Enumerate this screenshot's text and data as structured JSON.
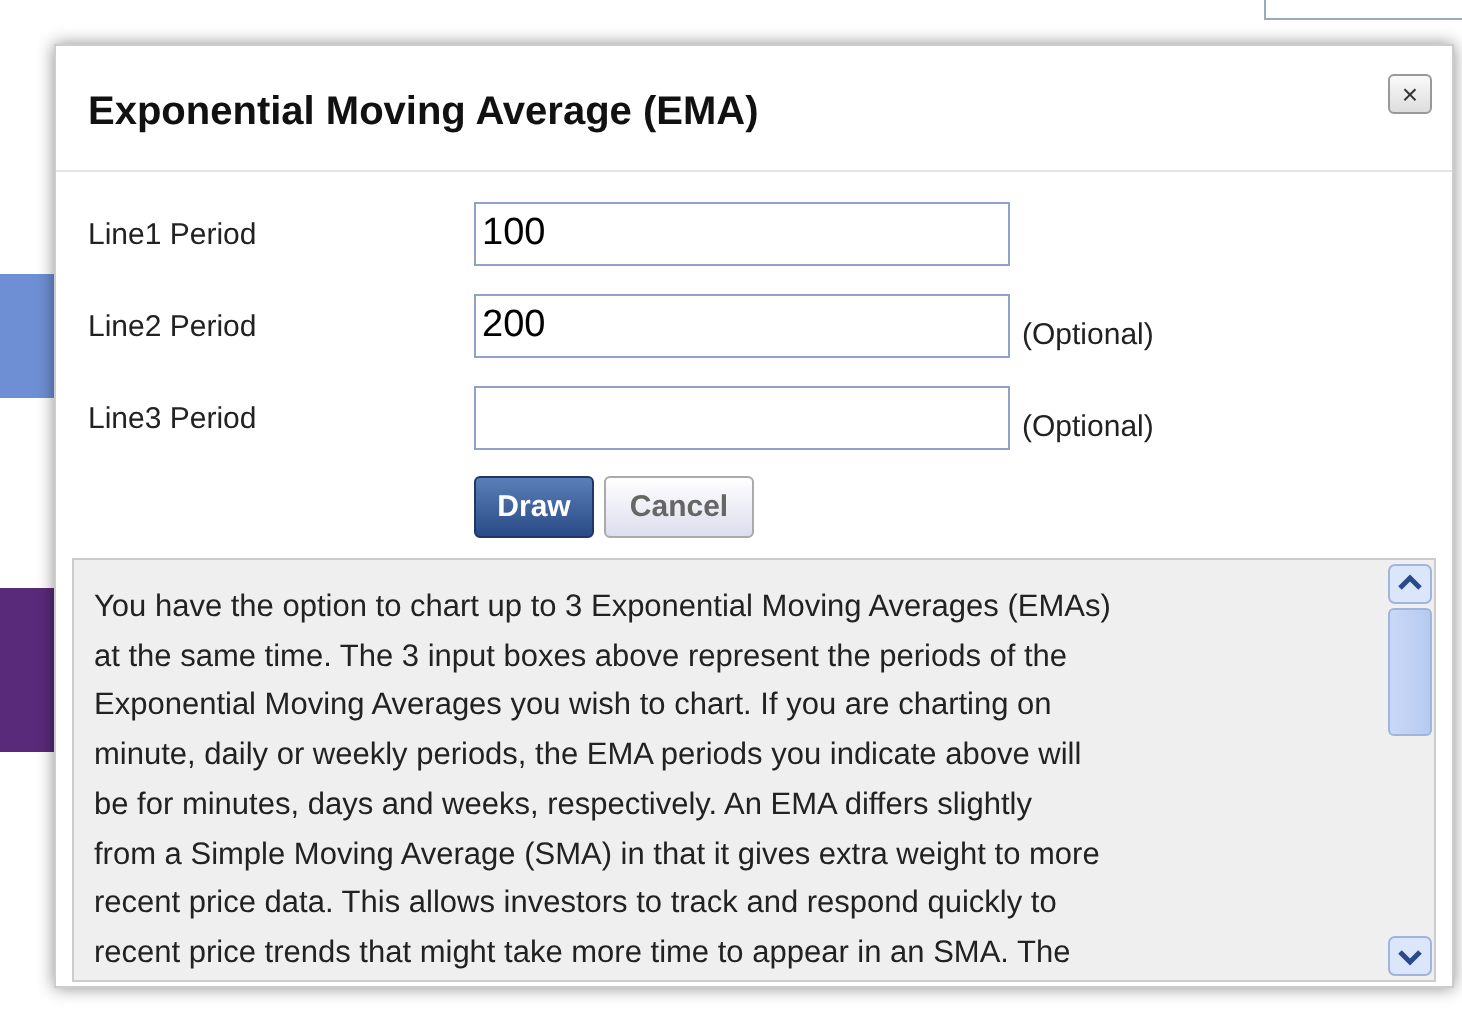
{
  "dialog": {
    "title": "Exponential Moving Average (EMA)",
    "close": "×"
  },
  "fields": [
    {
      "label": "Line1 Period",
      "value": "100"
    },
    {
      "label": "Line2 Period",
      "value": "200",
      "note": "(Optional)"
    },
    {
      "label": "Line3 Period",
      "note": "(Optional)"
    }
  ],
  "buttons": [
    {
      "label": "Draw",
      "kind": "primary"
    },
    {
      "label": "Cancel",
      "kind": "secondary"
    }
  ],
  "help": {
    "lines": [
      "You have the option to chart up to 3 Exponential Moving Averages (EMAs)",
      "at the same time. The 3 input boxes above represent the periods of the",
      "Exponential Moving Averages you wish to chart. If you are charting on",
      "minute, daily or weekly periods, the EMA periods you indicate above will",
      "be for minutes, days and weeks, respectively. An EMA differs slightly",
      "from a Simple Moving Average (SMA) in that it gives extra weight to more",
      "recent price data. This allows investors to track and respond quickly to",
      "recent price trends that might take more time to appear in an SMA. The"
    ]
  }
}
